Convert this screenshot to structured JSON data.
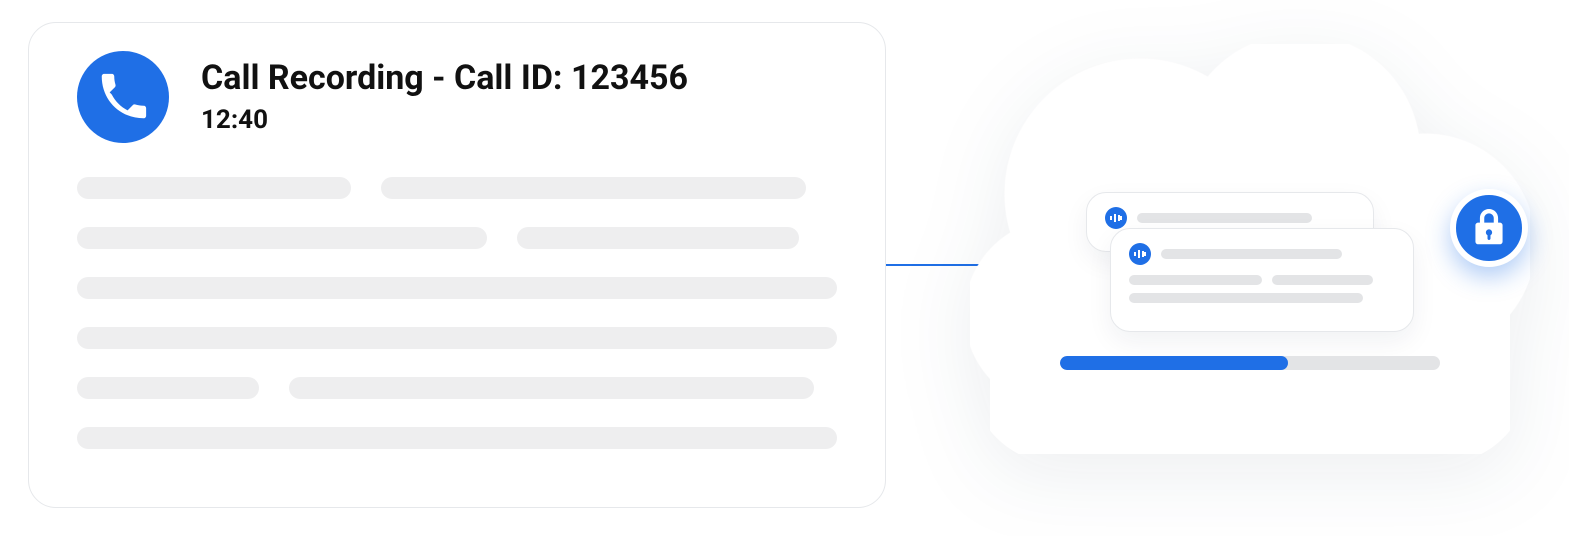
{
  "colors": {
    "accent": "#1f6fe6",
    "placeholder": "#eeeeef",
    "placeholder_dark": "#e3e4e6",
    "border": "#e6e8eb"
  },
  "call": {
    "icon": "phone-icon",
    "title": "Call Recording - Call ID: 123456",
    "duration": "12:40"
  },
  "transcript_placeholder_rows": [
    [
      36,
      56
    ],
    [
      54,
      37
    ],
    [
      100
    ],
    [
      100
    ],
    [
      24,
      69
    ],
    [
      100
    ]
  ],
  "cloud": {
    "lock_icon": "lock-icon",
    "mini_cards": [
      {
        "audio_icon": "soundwave-icon",
        "title_width_pct": 70
      },
      {
        "audio_icon": "soundwave-icon",
        "title_width_pct": 68,
        "body_rows": [
          [
            50,
            38
          ],
          [
            88
          ]
        ]
      }
    ],
    "progress_pct": 60
  }
}
